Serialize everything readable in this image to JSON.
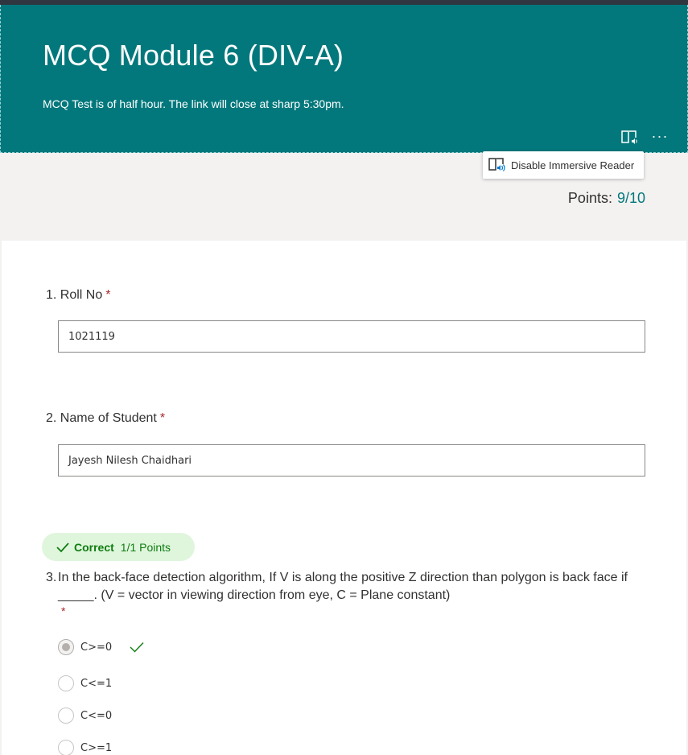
{
  "form": {
    "title": "MCQ Module 6 (DIV-A)",
    "subtitle": "MCQ Test is of half hour. The link will close at sharp 5:30pm.",
    "more_label": "···"
  },
  "immersive": {
    "tooltip_label": "Disable Immersive Reader",
    "icon": "immersive-reader-icon"
  },
  "score": {
    "label": "Points:",
    "value": "9/10"
  },
  "questions": [
    {
      "number": "1.",
      "label": "Roll No",
      "required": "*",
      "answer": "1021119"
    },
    {
      "number": "2.",
      "label": "Name of Student",
      "required": "*",
      "answer": "Jayesh Nilesh Chaidhari"
    },
    {
      "number": "3.",
      "label": "In the back-face detection algorithm, If V is along the positive Z direction than polygon is back face if _____. (V = vector in viewing direction from eye, C = Plane constant)",
      "required": "*",
      "result": {
        "status": "Correct",
        "points": "1/1 Points"
      },
      "options": [
        {
          "label": "C>=0",
          "selected": true,
          "correct": true
        },
        {
          "label": "C<=1",
          "selected": false
        },
        {
          "label": "C<=0",
          "selected": false
        },
        {
          "label": "C>=1",
          "selected": false
        }
      ]
    }
  ],
  "colors": {
    "header_bg": "#03787c",
    "accent": "#03787c",
    "correct_bg": "#dff6dd",
    "correct_text": "#107c10",
    "required": "#a4262c"
  }
}
